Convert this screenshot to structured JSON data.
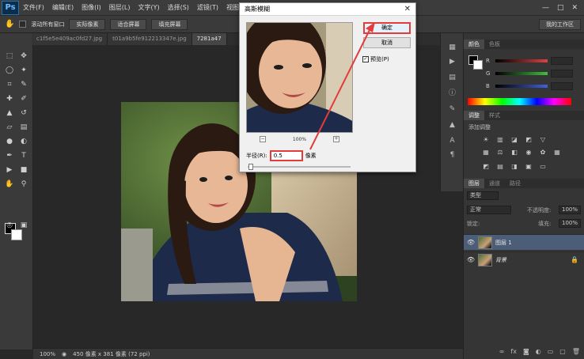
{
  "app": {
    "logo": "Ps"
  },
  "menu": [
    "文件(F)",
    "编辑(E)",
    "图像(I)",
    "图层(L)",
    "文字(Y)",
    "选择(S)",
    "滤镜(T)",
    "视图(V)"
  ],
  "window_controls": [
    "—",
    "□",
    "✕"
  ],
  "options_bar": {
    "scroll_all_label": "滚动所有窗口",
    "actual_pixels": "实际像素",
    "fit_screen": "适合屏幕",
    "fill_screen": "填充屏幕",
    "workspace": "我的工作区"
  },
  "tabs": [
    {
      "label": "c1f5e5e409ac0fd27.jpg",
      "active": false
    },
    {
      "label": "t01a9b5fe912213347e.jpg",
      "active": false
    },
    {
      "label": "7281a47",
      "active": true
    }
  ],
  "status": {
    "zoom": "100%",
    "dimensions": "450 像素 x 381 像素 (72 ppi)"
  },
  "dialog": {
    "title": "高斯模糊",
    "close": "✕",
    "ok": "确定",
    "cancel": "取消",
    "preview_label": "预览(P)",
    "preview_checked": true,
    "zoom": "100%",
    "zoom_out": "−",
    "zoom_in": "+",
    "radius_label": "半径(R):",
    "radius_value": "0.5",
    "radius_unit": "像素"
  },
  "panels": {
    "color_tabs": [
      "颜色",
      "色板"
    ],
    "channels": [
      {
        "letter": "R",
        "color": "#e04040"
      },
      {
        "letter": "G",
        "color": "#3fbf3f"
      },
      {
        "letter": "B",
        "color": "#4060e0"
      }
    ],
    "adjust_tabs": [
      "调整",
      "样式"
    ],
    "adjust_title": "添加调整",
    "layers_tabs": [
      "图层",
      "通道",
      "路径"
    ],
    "kind_label": "类型",
    "blend_mode": "正常",
    "opacity_label": "不透明度:",
    "opacity_value": "100%",
    "lock_label": "锁定:",
    "fill_label": "填充:",
    "fill_value": "100%",
    "layers": [
      {
        "name": "图层 1",
        "selected": true,
        "locked": false
      },
      {
        "name": "背景",
        "selected": false,
        "locked": true
      }
    ]
  },
  "colors": {
    "accent_red": "#e23c3c",
    "selected_layer": "#4c5d77"
  }
}
